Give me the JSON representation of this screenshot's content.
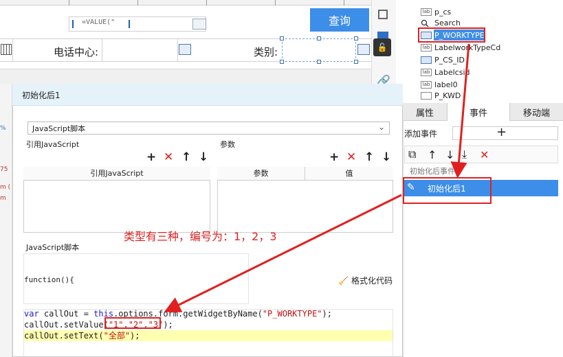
{
  "designer": {
    "formula_text": "=VALUE(\"",
    "query_button": "查询",
    "phone_label": "电话中心:",
    "type_label": "类别:"
  },
  "widget_tree": {
    "items": [
      {
        "name": "p_cs",
        "icon": "label-icon"
      },
      {
        "name": "Search",
        "icon": "search-icon"
      },
      {
        "name": "P_WORKTYPE",
        "icon": "dropdown-widget-icon"
      },
      {
        "name": "LabelworkTypeCd",
        "icon": "label-icon"
      },
      {
        "name": "P_CS_ID",
        "icon": "dropdown-widget-icon"
      },
      {
        "name": "Labelcsid",
        "icon": "label-icon"
      },
      {
        "name": "label0",
        "icon": "label-icon"
      },
      {
        "name": "P_KWD",
        "icon": "table-icon"
      }
    ]
  },
  "props": {
    "tabs": [
      "属性",
      "事件",
      "移动端"
    ],
    "active_tab": "事件",
    "add_event_label": "添加事件",
    "event_group": "初始化后事件",
    "event_item": "初始化后1"
  },
  "dialog": {
    "title": "初始化后1",
    "script_type": "JavaScript脚本",
    "ref_js_label": "引用JavaScript",
    "params_label": "参数",
    "ref_js_header": "引用JavaScript",
    "param_header": "参数",
    "value_header": "值",
    "js_script_label": "JavaScript脚本",
    "function_text": "function(){",
    "format_button": "格式化代码",
    "code": {
      "line1_kw1": "var",
      "line1_a": " callOut = ",
      "line1_kw2": "this",
      "line1_b": ".options.form.getWidgetByName(",
      "line1_str": "\"P_WORKTYPE\"",
      "line1_c": ");",
      "line2_a": "callOut.setValue(",
      "line2_str": "\"1\",\"2\",\"3\"",
      "line2_c": ");",
      "line3_a": "callOut.setText(",
      "line3_str": "\"全部\"",
      "line3_c": ");"
    }
  },
  "annotation": "类型有三种，编号为：1，2，3",
  "left_strip": [
    "%",
    "75",
    "m (",
    "m"
  ],
  "colors": {
    "accent": "#3d8ee8",
    "annotation_red": "#e02020",
    "dialog_title_bg": "#e6f2fa",
    "code_highlight": "#ffffb0"
  }
}
